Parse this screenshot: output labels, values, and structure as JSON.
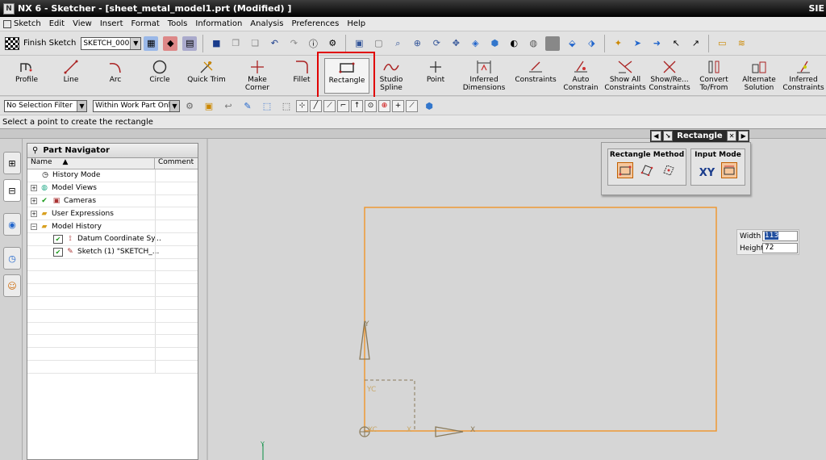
{
  "window": {
    "title": "NX 6 - Sketcher - [sheet_metal_model1.prt (Modified) ]",
    "brand": "SIE"
  },
  "menu": [
    "Sketch",
    "Edit",
    "View",
    "Insert",
    "Format",
    "Tools",
    "Information",
    "Analysis",
    "Preferences",
    "Help"
  ],
  "toolbar1": {
    "finish_label": "Finish Sketch",
    "sketch_name": "SKETCH_000"
  },
  "tools": [
    {
      "label": "Profile",
      "icon": "profile-icon"
    },
    {
      "label": "Line",
      "icon": "line-icon"
    },
    {
      "label": "Arc",
      "icon": "arc-icon"
    },
    {
      "label": "Circle",
      "icon": "circle-icon"
    },
    {
      "label": "Quick Trim",
      "icon": "quick-trim-icon"
    },
    {
      "label": "Make Corner",
      "icon": "make-corner-icon"
    },
    {
      "label": "Fillet",
      "icon": "fillet-icon"
    },
    {
      "label": "Rectangle",
      "icon": "rectangle-icon"
    },
    {
      "label": "Studio Spline",
      "icon": "studio-spline-icon"
    },
    {
      "label": "Point",
      "icon": "point-icon"
    },
    {
      "label": "Inferred Dimensions",
      "icon": "inferred-dimensions-icon"
    },
    {
      "label": "Constraints",
      "icon": "constraints-icon"
    },
    {
      "label": "Auto Constrain",
      "icon": "auto-constrain-icon"
    },
    {
      "label": "Show All Constraints",
      "icon": "show-all-constraints-icon"
    },
    {
      "label": "Show/Re... Constraints",
      "icon": "show-remove-constraints-icon"
    },
    {
      "label": "Convert To/From",
      "icon": "convert-icon"
    },
    {
      "label": "Alternate Solution",
      "icon": "alternate-solution-icon"
    },
    {
      "label": "Inferred Constraints",
      "icon": "inferred-constraints-icon"
    }
  ],
  "filters": {
    "selection_filter": "No Selection Filter",
    "scope": "Within Work Part Only"
  },
  "status": {
    "prompt": "Select a point to create the rectangle"
  },
  "navigator": {
    "title": "Part Navigator",
    "col_name": "Name",
    "col_comment": "Comment",
    "rows": [
      {
        "label": "History Mode"
      },
      {
        "label": "Model Views"
      },
      {
        "label": "Cameras"
      },
      {
        "label": "User Expressions"
      },
      {
        "label": "Model History"
      },
      {
        "label": "Datum Coordinate Sy..."
      },
      {
        "label": "Sketch (1) \"SKETCH_..."
      }
    ]
  },
  "rect_dialog": {
    "title": "Rectangle",
    "method_label": "Rectangle Method",
    "input_label": "Input Mode",
    "xy_label": "XY"
  },
  "dims": {
    "width_label": "Width",
    "width_value": "113",
    "height_label": "Height",
    "height_value": "72"
  },
  "axes": {
    "y": "Y",
    "yc": "YC",
    "xc": "XC",
    "x": "X",
    "x_short": "X"
  }
}
